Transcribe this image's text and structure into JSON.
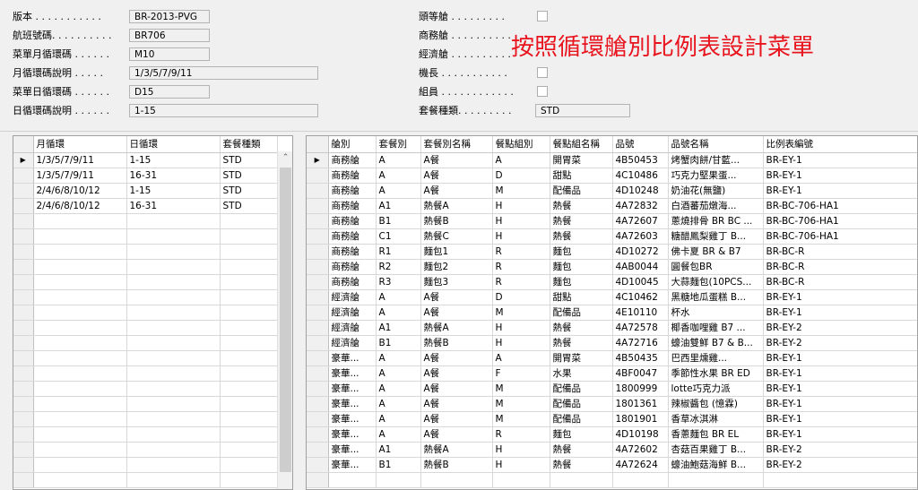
{
  "header_left": [
    {
      "label": "版本 . . . . . . . . . . .",
      "value": "BR-2013-PVG"
    },
    {
      "label": "航班號碼. . . . . . . . . .",
      "value": "BR706"
    },
    {
      "label": "菜單月循環碼 . . . . . .",
      "value": "M10"
    },
    {
      "label": "月循環碼說明 . . . . .",
      "value": "1/3/5/7/9/11"
    },
    {
      "label": "菜單日循環碼 . . . . . .",
      "value": "D15"
    },
    {
      "label": "日循環碼說明 . . . . . .",
      "value": "1-15"
    }
  ],
  "header_right": {
    "first_class": {
      "label": "頭等艙 . . . . . . . . ."
    },
    "business": {
      "label": "商務艙 . . . . . . . . . ."
    },
    "economy": {
      "label": "經濟艙 . . . . . . . . . ."
    },
    "captain": {
      "label": "機長 . . . . . . . . . . ."
    },
    "crew": {
      "label": "組員 . . . . . . . . . . . ."
    },
    "meal_type": {
      "label": "套餐種類. . . . . . . . .",
      "value": "STD"
    }
  },
  "overlay_title": "按照循環艙別比例表設計菜單",
  "left_grid": {
    "columns": [
      "月循環",
      "日循環",
      "套餐種類"
    ],
    "rows": [
      [
        "1/3/5/7/9/11",
        "1-15",
        "STD"
      ],
      [
        "1/3/5/7/9/11",
        "16-31",
        "STD"
      ],
      [
        "2/4/6/8/10/12",
        "1-15",
        "STD"
      ],
      [
        "2/4/6/8/10/12",
        "16-31",
        "STD"
      ]
    ],
    "current_row_marker": "▶"
  },
  "right_grid": {
    "columns": [
      "艙別",
      "套餐別",
      "套餐別名稱",
      "餐點組別",
      "餐點組名稱",
      "品號",
      "品號名稱",
      "比例表編號"
    ],
    "rows": [
      [
        "商務艙",
        "A",
        "A餐",
        "A",
        "開胃菜",
        "4B50453",
        "烤蟹肉餅/甘藍...",
        "BR-EY-1"
      ],
      [
        "商務艙",
        "A",
        "A餐",
        "D",
        "甜點",
        "4C10486",
        "巧克力堅果蛋...",
        "BR-EY-1"
      ],
      [
        "商務艙",
        "A",
        "A餐",
        "M",
        "配備品",
        "4D10248",
        "奶油花(無鹽)",
        "BR-EY-1"
      ],
      [
        "商務艙",
        "A1",
        "熱餐A",
        "H",
        "熱餐",
        "4A72832",
        "白酒蕃茄燉海...",
        "BR-BC-706-HA1"
      ],
      [
        "商務艙",
        "B1",
        "熱餐B",
        "H",
        "熱餐",
        "4A72607",
        "蔥燒排骨 BR BC ...",
        "BR-BC-706-HA1"
      ],
      [
        "商務艙",
        "C1",
        "熱餐C",
        "H",
        "熱餐",
        "4A72603",
        "糖醋鳳梨雞丁 B...",
        "BR-BC-706-HA1"
      ],
      [
        "商務艙",
        "R1",
        "麵包1",
        "R",
        "麵包",
        "4D10272",
        "佛卡夏 BR & B7",
        "BR-BC-R"
      ],
      [
        "商務艙",
        "R2",
        "麵包2",
        "R",
        "麵包",
        "4AB0044",
        "圓餐包BR",
        "BR-BC-R"
      ],
      [
        "商務艙",
        "R3",
        "麵包3",
        "R",
        "麵包",
        "4D10045",
        "大蒜麵包(10PCS...",
        "BR-BC-R"
      ],
      [
        "經濟艙",
        "A",
        "A餐",
        "D",
        "甜點",
        "4C10462",
        "黑糖地瓜蛋糕 B...",
        "BR-EY-1"
      ],
      [
        "經濟艙",
        "A",
        "A餐",
        "M",
        "配備品",
        "4E10110",
        "杯水",
        "BR-EY-1"
      ],
      [
        "經濟艙",
        "A1",
        "熱餐A",
        "H",
        "熱餐",
        "4A72578",
        "椰香咖哩雞 B7 ...",
        "BR-EY-2"
      ],
      [
        "經濟艙",
        "B1",
        "熱餐B",
        "H",
        "熱餐",
        "4A72716",
        "蠔油雙鮮 B7 & B...",
        "BR-EY-2"
      ],
      [
        "豪華...",
        "A",
        "A餐",
        "A",
        "開胃菜",
        "4B50435",
        "巴西里燻雞...",
        "BR-EY-1"
      ],
      [
        "豪華...",
        "A",
        "A餐",
        "F",
        "水果",
        "4BF0047",
        "季節性水果 BR ED",
        "BR-EY-1"
      ],
      [
        "豪華...",
        "A",
        "A餐",
        "M",
        "配備品",
        "1800999",
        "lotte巧克力派",
        "BR-EY-1"
      ],
      [
        "豪華...",
        "A",
        "A餐",
        "M",
        "配備品",
        "1801361",
        "辣椒醬包 (憶霖)",
        "BR-EY-1"
      ],
      [
        "豪華...",
        "A",
        "A餐",
        "M",
        "配備品",
        "1801901",
        "香草冰淇淋",
        "BR-EY-1"
      ],
      [
        "豪華...",
        "A",
        "A餐",
        "R",
        "麵包",
        "4D10198",
        "香蔥麵包 BR EL",
        "BR-EY-1"
      ],
      [
        "豪華...",
        "A1",
        "熱餐A",
        "H",
        "熱餐",
        "4A72602",
        "杏菇百果雞丁 B...",
        "BR-EY-2"
      ],
      [
        "豪華...",
        "B1",
        "熱餐B",
        "H",
        "熱餐",
        "4A72624",
        "蠔油鮑菇海鮮 B...",
        "BR-EY-2"
      ]
    ],
    "current_row_marker": "▶"
  },
  "colors": {
    "overlay_title": "#e8141e",
    "window_bg": "#f0f0f0"
  }
}
